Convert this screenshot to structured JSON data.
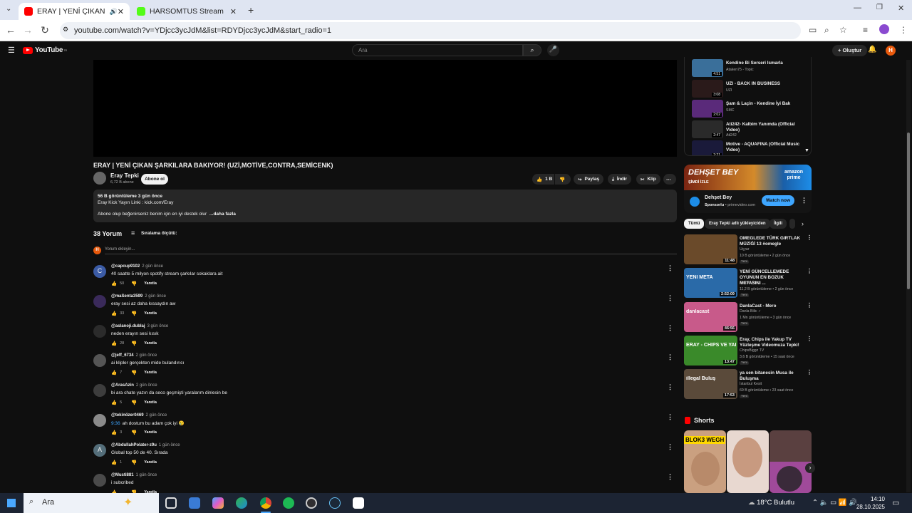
{
  "browser": {
    "tabs": [
      {
        "title": "ERAY | YENİ ÇIKAN ŞARKILA",
        "active": true
      },
      {
        "title": "HARSOMTUS Stream - Watch L",
        "active": false
      }
    ],
    "url": "youtube.com/watch?v=YDjcc3ycJdM&list=RDYDjcc3ycJdM&start_radio=1"
  },
  "yt": {
    "logo": "YouTube",
    "logo_region": "TR",
    "search_placeholder": "Ara",
    "create_label": "Oluştur",
    "avatar_letter": "H"
  },
  "video": {
    "title": "ERAY | YENİ ÇIKAN ŞARKILARA BAKIYOR! (UZİ,MOTİVE,CONTRA,SEMİCENK)",
    "channel": "Eray Tepki",
    "subs": "6,72 B abone",
    "subscribe": "Abone ol",
    "likes": "1 B",
    "share": "Paylaş",
    "download": "İndir",
    "clip": "Klip",
    "desc_meta": "56 B görüntüleme  3 gün önce",
    "desc_line1": "Eray Kick Yayın Linki : kick.com/Eray",
    "desc_line2": "Abone olup beğenirseniz benim için en iyi destek olur",
    "desc_more": "...daha fazla"
  },
  "comments_section": {
    "count_label": "38 Yorum",
    "sort_label": "Sıralama ölçütü:",
    "add_placeholder": "Yorum ekleyin...",
    "reply_label": "Yanıtla",
    "items": [
      {
        "user": "@capcup9102",
        "time": "2 gün önce",
        "text": "40 saatte 5 milyon spotify stream şarkılar sokaklara ait",
        "likes": "50",
        "avatar": "C",
        "avatar_color": "#3b5ba5"
      },
      {
        "user": "@maSenta3599",
        "time": "2 gün önce",
        "text": "eray sesi az daha kıssaydın aw",
        "likes": "33",
        "avatar": "",
        "avatar_color": "#3a2a5a"
      },
      {
        "user": "@aslanoji.dublaj",
        "time": "3 gün önce",
        "text": "neden erayın sesi kısık",
        "likes": "28",
        "avatar": "",
        "avatar_color": "#2b2b2b"
      },
      {
        "user": "@jeff_6734",
        "time": "2 gün önce",
        "text": "ai klipler gerçekten mide bulandırıcı",
        "likes": "7",
        "avatar": "",
        "avatar_color": "#555555"
      },
      {
        "user": "@ArasAzin",
        "time": "2 gün önce",
        "text": "bi ara chate yazın da seco geçmişti yaralanm dinlesin be",
        "likes": "5",
        "avatar": "",
        "avatar_color": "#3d3d3d"
      },
      {
        "user": "@tekinözer0469",
        "time": "2 gün önce",
        "timestamp": "9:36",
        "text": "ah dostum bu adam çok iyi 😢",
        "likes": "3",
        "avatar": "",
        "avatar_color": "#8a8a8a"
      },
      {
        "user": "@AbdullahPolater-z9u",
        "time": "1 gün önce",
        "text": "Global top 50 de 40. Sırada",
        "likes": "1",
        "avatar": "A",
        "avatar_color": "#546e7a"
      },
      {
        "user": "@Musti881",
        "time": "1 gün önce",
        "text": "i subcribed",
        "likes": "",
        "avatar": "",
        "avatar_color": "#4a4a4a"
      }
    ]
  },
  "playlist": [
    {
      "title": "Kendine Bi Serseri Ismarla",
      "channel": "Ataken75 - Topic",
      "duration": "4:51",
      "color": "#3a6f9a"
    },
    {
      "title": "UZI - BACK IN BUSINESS",
      "channel": "UZI",
      "duration": "3:08",
      "color": "#2a1a1a"
    },
    {
      "title": "Şam & Laçin - Kendine İyi Bak",
      "channel": "SMC",
      "duration": "2:02",
      "color": "#5a2a7a"
    },
    {
      "title": "Ati242- Kalbim Yanımda (Official Video)",
      "channel": "Ati242",
      "duration": "2:47",
      "color": "#2a2a2a"
    },
    {
      "title": "Motive - AQUAFINA (Official Music Video)",
      "channel": "",
      "duration": "2:21",
      "color": "#1a1a3a"
    }
  ],
  "ad": {
    "banner_title": "DEHŞET BEY",
    "banner_sub": "ŞİMDİ İZLE",
    "brand_line1": "amazon",
    "brand_line2": "prime",
    "name": "Dehşet Bey",
    "sponsor": "Sponsorlu",
    "domain": "primevideo.com",
    "cta": "Watch now"
  },
  "chips": [
    "Tümü",
    "Eray Tepki adlı yükleyiciden",
    "İlgili"
  ],
  "related": [
    {
      "title": "OMEGLEDE TÜRK GIRTLAK MÜZİĞİ 13 #omegle",
      "channel": "Uçyar",
      "meta": "10 B görüntüleme • 2 gün önce",
      "badge": "Yeni",
      "duration": "11:48",
      "color": "#6a4a2a"
    },
    {
      "title": "YENİ GÜNCELLEMEDE OYUNUN EN BOZUK METASINI ...",
      "channel": "Sensei Rust",
      "meta": "11,2 B görüntüleme • 2 gün önce",
      "badge": "Yeni",
      "duration": "2:52:09",
      "color": "#2a6aa8",
      "overlay": "YENİ META"
    },
    {
      "title": "DanlaCast - Mero",
      "channel": "Danla Bilic ✓",
      "meta": "1 Mn görüntüleme • 3 gün önce",
      "badge": "Yeni",
      "duration": "46:56",
      "color": "#c85a8a",
      "overlay": "danlacast"
    },
    {
      "title": "Eray, Chips ile Yakup TV Yüzleşme Videomuza Tepki!",
      "channel": "ChipsBiggz TV",
      "meta": "3,6 B görüntüleme • 15 saat önce",
      "badge": "Yeni",
      "duration": "13:47",
      "color": "#3a8a2a",
      "overlay": "ERAY - CHIPS VE YAKUP TV"
    },
    {
      "title": "ya sen bitanesin Musa ile Buluşma",
      "channel": "İstanbul Kesit",
      "meta": "69 B görüntüleme • 23 saat önce",
      "badge": "Yeni",
      "duration": "17:53",
      "color": "#5a4a3a",
      "overlay": "illegal Buluş"
    }
  ],
  "shorts": {
    "heading": "Shorts",
    "items": [
      {
        "label": "BLOK3  WEGH",
        "color": "#caa080"
      },
      {
        "label": "",
        "color": "#e8d8d0"
      },
      {
        "label": "",
        "color": "#a04a9a"
      }
    ]
  },
  "taskbar": {
    "search": "Ara",
    "weather": "18°C  Bulutlu",
    "time": "14:10",
    "date": "28.10.2025"
  }
}
